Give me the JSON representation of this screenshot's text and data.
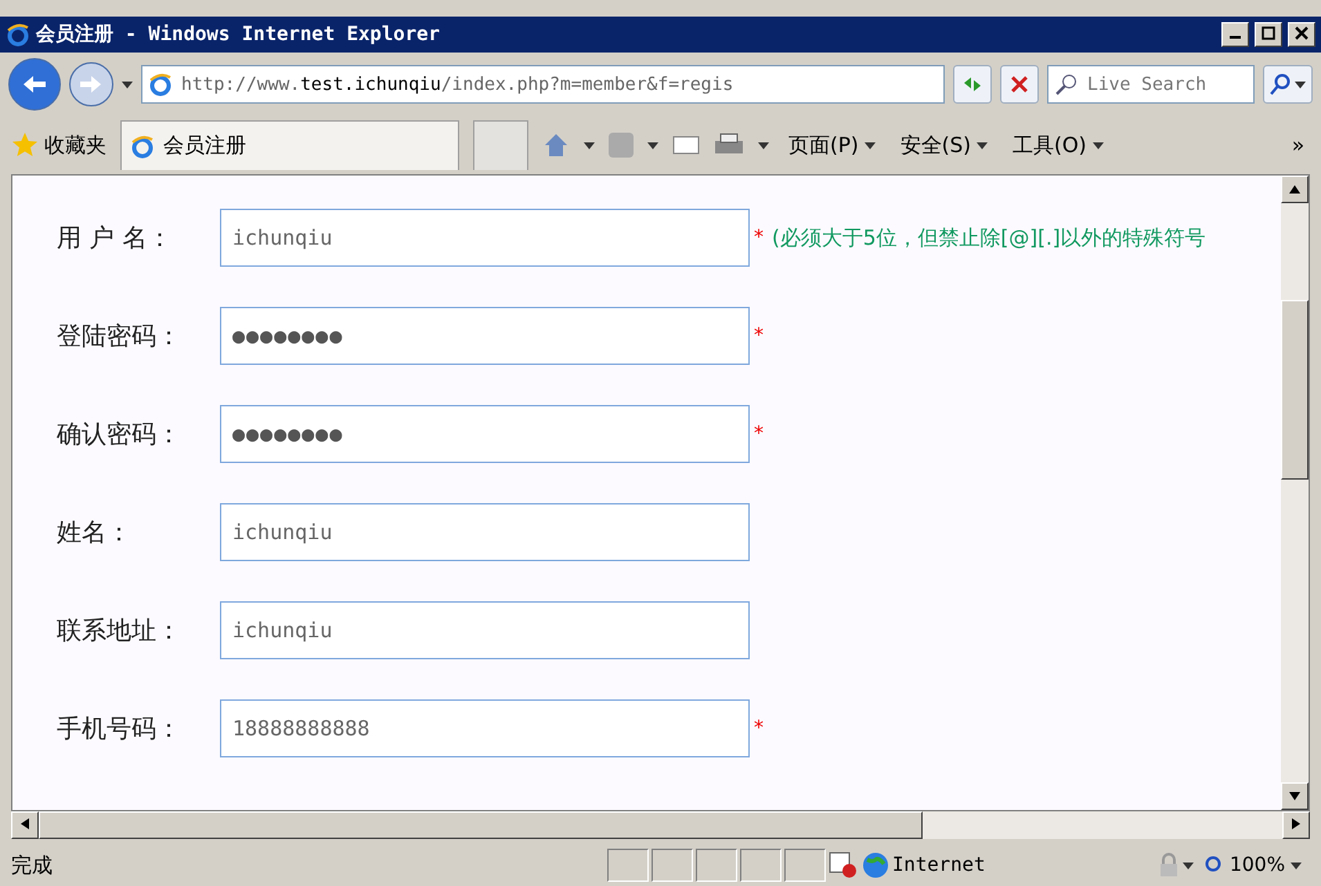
{
  "window": {
    "title": "会员注册 - Windows Internet Explorer"
  },
  "address_bar": {
    "url_prefix": "http://www.",
    "url_host": "test.ichunqiu",
    "url_path": "/index.php?m=member&f=regis"
  },
  "search": {
    "placeholder": "Live Search"
  },
  "favorites_bar": {
    "favorites": "收藏夹",
    "tab": "会员注册",
    "commands": [
      {
        "label": "页面(P)"
      },
      {
        "label": "安全(S)"
      },
      {
        "label": "工具(O)"
      }
    ],
    "more": "»"
  },
  "form": {
    "fields": [
      {
        "label": "用 户 名：",
        "value": "ichunqiu",
        "mark": "*",
        "hint": "(必须大于5位，但禁止除[@][.]以外的特殊符号"
      },
      {
        "label": "登陆密码：",
        "value": "●●●●●●●●",
        "mark": "*"
      },
      {
        "label": "确认密码：",
        "value": "●●●●●●●●",
        "mark": "*"
      },
      {
        "label": "姓名：",
        "value": "ichunqiu"
      },
      {
        "label": "联系地址：",
        "value": "ichunqiu"
      },
      {
        "label": "手机号码：",
        "value": "18888888888",
        "mark": "*"
      }
    ]
  },
  "status_bar": {
    "status": "完成",
    "zone": "Internet",
    "zoom": "100%"
  }
}
